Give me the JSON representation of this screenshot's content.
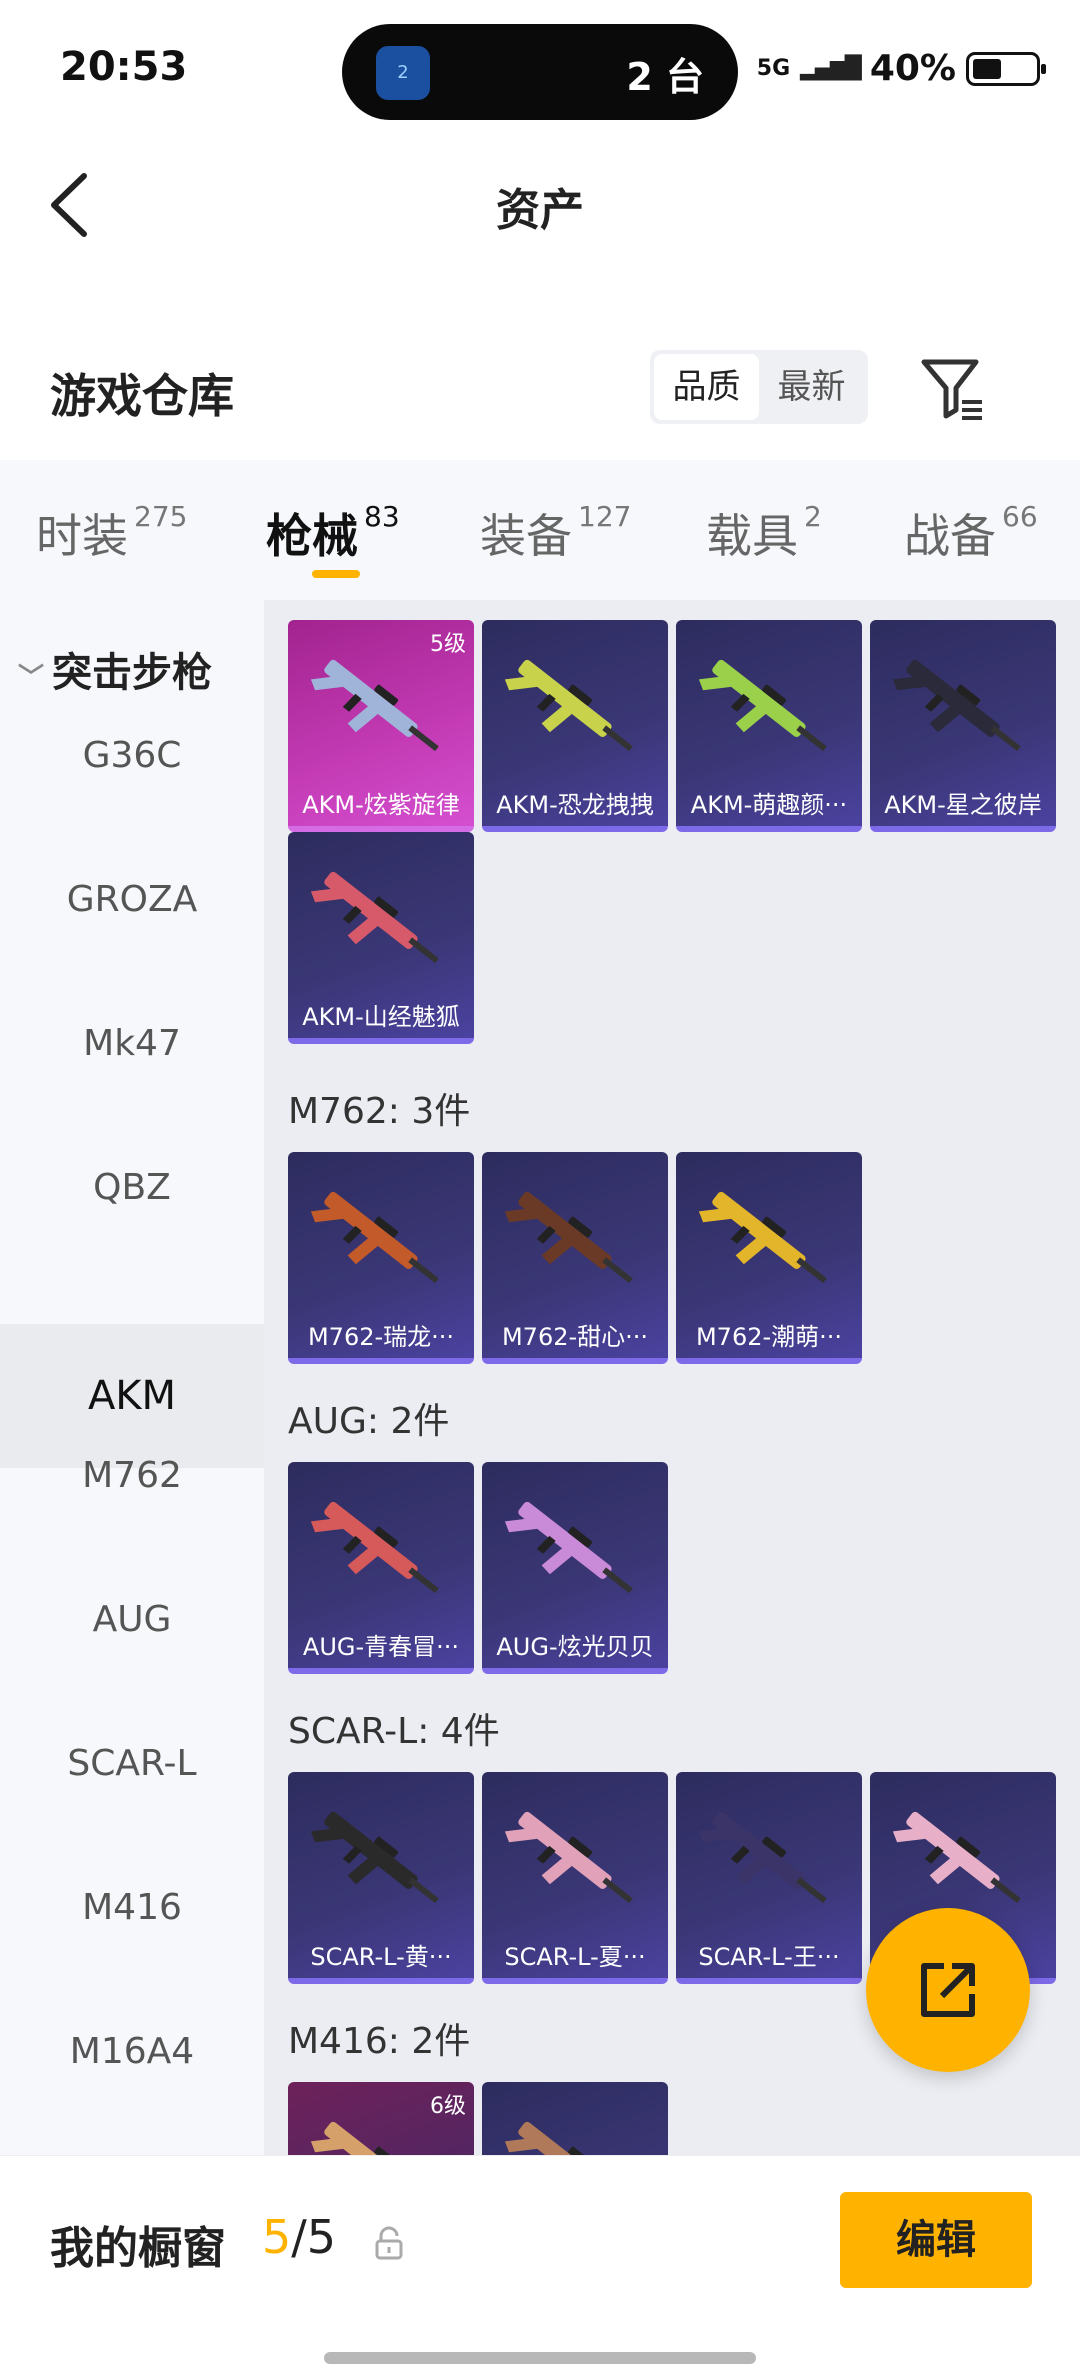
{
  "status_bar": {
    "time": "20:53",
    "island_badge": "2",
    "island_text": "2 台",
    "network": "5G",
    "battery": "40%"
  },
  "nav": {
    "title": "资产"
  },
  "section": {
    "title": "游戏仓库",
    "sort_options": [
      "品质",
      "最新"
    ],
    "sort_selected": "品质"
  },
  "tabs": [
    {
      "label": "时装",
      "count": "275"
    },
    {
      "label": "枪械",
      "count": "83",
      "active": true
    },
    {
      "label": "装备",
      "count": "127"
    },
    {
      "label": "载具",
      "count": "2"
    },
    {
      "label": "战备",
      "count": "66"
    }
  ],
  "left_nav": {
    "category": "突击步枪",
    "items": [
      "G36C",
      "GROZA",
      "Mk47",
      "QBZ",
      "AKM",
      "M762",
      "AUG",
      "SCAR-L",
      "M416",
      "M16A4"
    ],
    "selected": "AKM"
  },
  "groups": [
    {
      "label": "",
      "items": [
        {
          "name": "AKM-炫紫旋律",
          "tier": "5级",
          "rarity": "legendary",
          "color": "#9fb4d8"
        },
        {
          "name": "AKM-恐龙拽拽",
          "rarity": "epic",
          "color": "#c8d24a"
        },
        {
          "name": "AKM-萌趣颜···",
          "rarity": "epic",
          "color": "#9ad04a"
        },
        {
          "name": "AKM-星之彼岸",
          "rarity": "epic",
          "color": "#2a2a3a"
        },
        {
          "name": "AKM-山经魅狐",
          "rarity": "epic",
          "color": "#d65a6a"
        }
      ]
    },
    {
      "label": "M762: 3件",
      "items": [
        {
          "name": "M762-瑞龙···",
          "rarity": "epic",
          "color": "#c25a2a"
        },
        {
          "name": "M762-甜心···",
          "rarity": "epic",
          "color": "#6a3a26"
        },
        {
          "name": "M762-潮萌···",
          "rarity": "epic",
          "color": "#e2b52a"
        }
      ]
    },
    {
      "label": "AUG: 2件",
      "items": [
        {
          "name": "AUG-青春冒···",
          "rarity": "epic",
          "color": "#d65a5a"
        },
        {
          "name": "AUG-炫光贝贝",
          "rarity": "epic",
          "color": "#c98ad8"
        }
      ]
    },
    {
      "label": "SCAR-L: 4件",
      "items": [
        {
          "name": "SCAR-L-黄···",
          "rarity": "epic",
          "color": "#2a2a2a"
        },
        {
          "name": "SCAR-L-夏···",
          "rarity": "epic",
          "color": "#e1a1b8"
        },
        {
          "name": "SCAR-L-王···",
          "rarity": "epic",
          "color": "#3a3468"
        },
        {
          "name": "",
          "rarity": "epic",
          "color": "#e8b0c8"
        }
      ]
    },
    {
      "label": "M416: 2件",
      "items": [
        {
          "name": "",
          "tier": "6级",
          "rarity": "legendary-dark",
          "color": "#d6a06a"
        },
        {
          "name": "",
          "rarity": "epic",
          "color": "#b07a5a"
        }
      ]
    }
  ],
  "bottom": {
    "label": "我的橱窗",
    "current": "5",
    "separator": "/",
    "total": "5",
    "edit_label": "编辑"
  },
  "colors": {
    "accent": "#ffb300",
    "legendary": "#c43bb5",
    "epic": "#3b3777"
  }
}
